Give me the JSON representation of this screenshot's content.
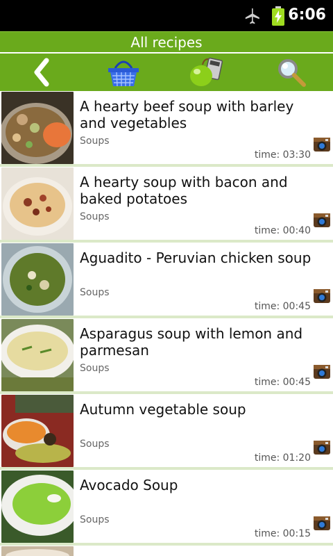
{
  "status": {
    "time": "6:06",
    "icons": [
      "airplane-icon",
      "battery-charging-icon"
    ]
  },
  "header": {
    "title": "All recipes"
  },
  "toolbar": {
    "buttons": [
      "back-arrow-icon",
      "shopping-basket-icon",
      "apple-calculator-icon",
      "magnifier-icon"
    ]
  },
  "list": {
    "items": [
      {
        "title": "A hearty beef soup with barley and vegetables",
        "category": "Soups",
        "time": "time: 03:30"
      },
      {
        "title": "A hearty soup with bacon and baked potatoes",
        "category": "Soups",
        "time": "time: 00:40"
      },
      {
        "title": "Aguadito - Peruvian chicken soup",
        "category": "Soups",
        "time": "time: 00:45"
      },
      {
        "title": "Asparagus soup with lemon and parmesan",
        "category": "Soups",
        "time": "time: 00:45"
      },
      {
        "title": "Autumn vegetable soup",
        "category": "Soups",
        "time": "time: 01:20"
      },
      {
        "title": "Avocado Soup",
        "category": "Soups",
        "time": "time: 00:15"
      }
    ]
  },
  "colors": {
    "accent": "#6aaa1c",
    "separator": "#dbe9c8"
  }
}
